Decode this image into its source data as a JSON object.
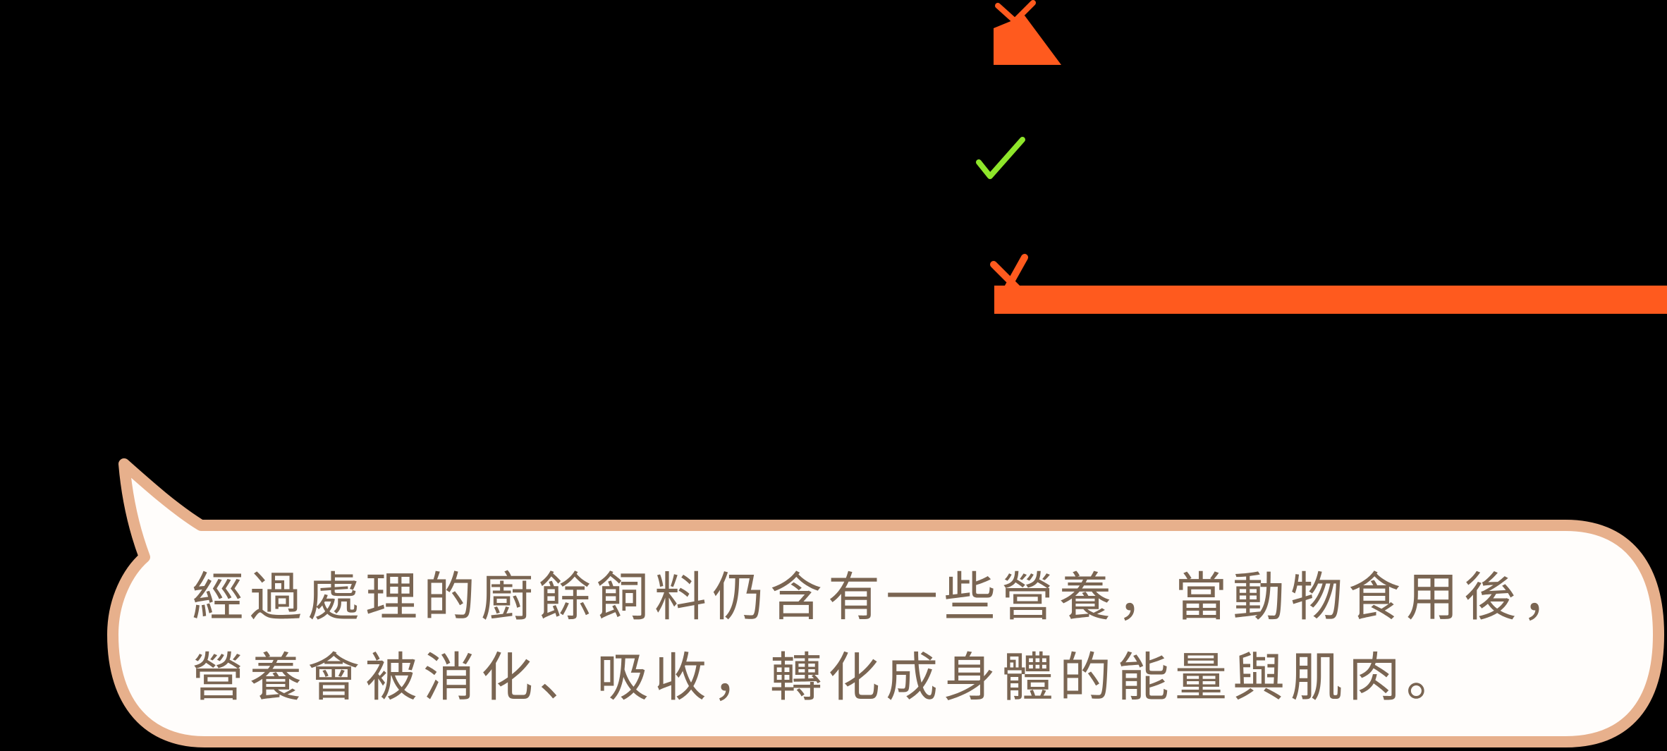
{
  "colors": {
    "background": "#000000",
    "cross_mark": "#ff5a1e",
    "check_mark": "#8ee62a",
    "orange_bar": "#ff5a1e",
    "bubble_fill": "#fffdfb",
    "bubble_border": "#e7b08c",
    "text": "#7a6552"
  },
  "icons": {
    "top": "cross-icon",
    "middle": "check-icon",
    "bottom": "cross-icon"
  },
  "speech_bubble": {
    "text": "經過處理的廚餘飼料仍含有一些營養，當動物食用後，營養會被消化、吸收，轉化成身體的能量與肌肉。"
  }
}
